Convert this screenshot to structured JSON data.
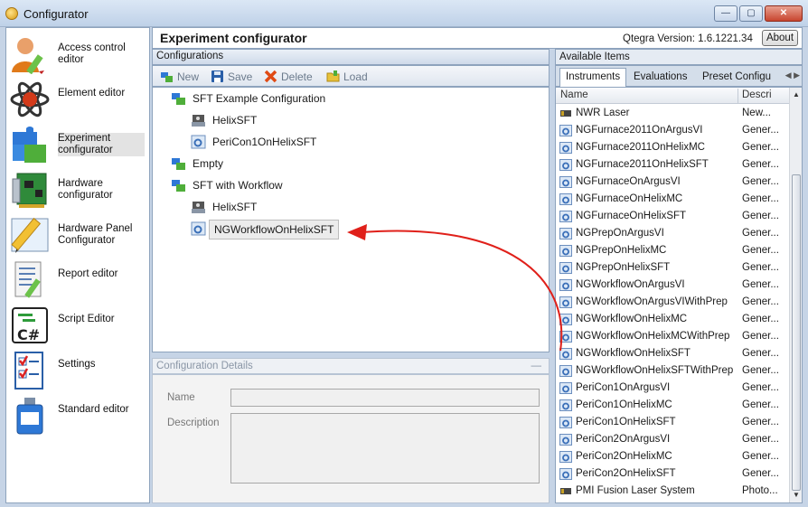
{
  "window": {
    "title": "Configurator",
    "minimize": "—",
    "maximize": "▢",
    "close": "✕"
  },
  "nav": [
    {
      "label": "Access control editor",
      "icon": "user-pencil-icon"
    },
    {
      "label": "Element editor",
      "icon": "atom-icon"
    },
    {
      "label": "Experiment configurator",
      "icon": "puzzle-icon"
    },
    {
      "label": "Hardware configurator",
      "icon": "circuit-board-icon"
    },
    {
      "label": "Hardware Panel Configurator",
      "icon": "pencil-icon"
    },
    {
      "label": "Report editor",
      "icon": "report-icon"
    },
    {
      "label": "Script Editor",
      "icon": "csharp-script-icon"
    },
    {
      "label": "Settings",
      "icon": "checklist-icon"
    },
    {
      "label": "Standard editor",
      "icon": "bottle-icon"
    }
  ],
  "header": {
    "title": "Experiment configurator",
    "version": "Qtegra Version: 1.6.1221.34",
    "about": "About"
  },
  "configurations": {
    "heading": "Configurations",
    "toolbar": {
      "new": "New",
      "save": "Save",
      "delete": "Delete",
      "load": "Load"
    },
    "tree": [
      {
        "label": "SFT Example Configuration",
        "icon": "puzzle-icon",
        "level": 0
      },
      {
        "label": "HelixSFT",
        "icon": "instrument-icon",
        "level": 1
      },
      {
        "label": "PeriCon1OnHelixSFT",
        "icon": "gear-doc-icon",
        "level": 1
      },
      {
        "label": "Empty",
        "icon": "puzzle-icon",
        "level": 0
      },
      {
        "label": "SFT with Workflow",
        "icon": "puzzle-icon",
        "level": 0
      },
      {
        "label": "HelixSFT",
        "icon": "instrument-icon",
        "level": 1
      },
      {
        "label": "NGWorkflowOnHelixSFT",
        "icon": "gear-doc-icon",
        "level": 1,
        "selected": true
      }
    ]
  },
  "details": {
    "heading": "Configuration Details",
    "collapse": "—",
    "name_label": "Name",
    "description_label": "Description",
    "name_value": "",
    "description_value": ""
  },
  "available": {
    "heading": "Available Items",
    "tabs": [
      "Instruments",
      "Evaluations",
      "Preset Configu"
    ],
    "tab_arrows": "◀ ▶",
    "columns": {
      "name": "Name",
      "description": "Descri"
    },
    "items": [
      {
        "name": "NWR Laser",
        "desc": "New...",
        "icon": "laser-icon"
      },
      {
        "name": "NGFurnace2011OnArgusVI",
        "desc": "Gener...",
        "icon": "gear-doc-icon"
      },
      {
        "name": "NGFurnace2011OnHelixMC",
        "desc": "Gener...",
        "icon": "gear-doc-icon"
      },
      {
        "name": "NGFurnace2011OnHelixSFT",
        "desc": "Gener...",
        "icon": "gear-doc-icon"
      },
      {
        "name": "NGFurnaceOnArgusVI",
        "desc": "Gener...",
        "icon": "gear-doc-icon"
      },
      {
        "name": "NGFurnaceOnHelixMC",
        "desc": "Gener...",
        "icon": "gear-doc-icon"
      },
      {
        "name": "NGFurnaceOnHelixSFT",
        "desc": "Gener...",
        "icon": "gear-doc-icon"
      },
      {
        "name": "NGPrepOnArgusVI",
        "desc": "Gener...",
        "icon": "gear-doc-icon"
      },
      {
        "name": "NGPrepOnHelixMC",
        "desc": "Gener...",
        "icon": "gear-doc-icon"
      },
      {
        "name": "NGPrepOnHelixSFT",
        "desc": "Gener...",
        "icon": "gear-doc-icon"
      },
      {
        "name": "NGWorkflowOnArgusVI",
        "desc": "Gener...",
        "icon": "gear-doc-icon"
      },
      {
        "name": "NGWorkflowOnArgusVIWithPrep",
        "desc": "Gener...",
        "icon": "gear-doc-icon"
      },
      {
        "name": "NGWorkflowOnHelixMC",
        "desc": "Gener...",
        "icon": "gear-doc-icon"
      },
      {
        "name": "NGWorkflowOnHelixMCWithPrep",
        "desc": "Gener...",
        "icon": "gear-doc-icon"
      },
      {
        "name": "NGWorkflowOnHelixSFT",
        "desc": "Gener...",
        "icon": "gear-doc-icon"
      },
      {
        "name": "NGWorkflowOnHelixSFTWithPrep",
        "desc": "Gener...",
        "icon": "gear-doc-icon"
      },
      {
        "name": "PeriCon1OnArgusVI",
        "desc": "Gener...",
        "icon": "gear-doc-icon"
      },
      {
        "name": "PeriCon1OnHelixMC",
        "desc": "Gener...",
        "icon": "gear-doc-icon"
      },
      {
        "name": "PeriCon1OnHelixSFT",
        "desc": "Gener...",
        "icon": "gear-doc-icon"
      },
      {
        "name": "PeriCon2OnArgusVI",
        "desc": "Gener...",
        "icon": "gear-doc-icon"
      },
      {
        "name": "PeriCon2OnHelixMC",
        "desc": "Gener...",
        "icon": "gear-doc-icon"
      },
      {
        "name": "PeriCon2OnHelixSFT",
        "desc": "Gener...",
        "icon": "gear-doc-icon"
      },
      {
        "name": "PMI Fusion Laser System",
        "desc": "Photo...",
        "icon": "laser-icon"
      }
    ]
  },
  "colors": {
    "annotation_arrow": "#e0201a",
    "accent_blue": "#2f6fd1",
    "frame": "#8ea3bd"
  }
}
